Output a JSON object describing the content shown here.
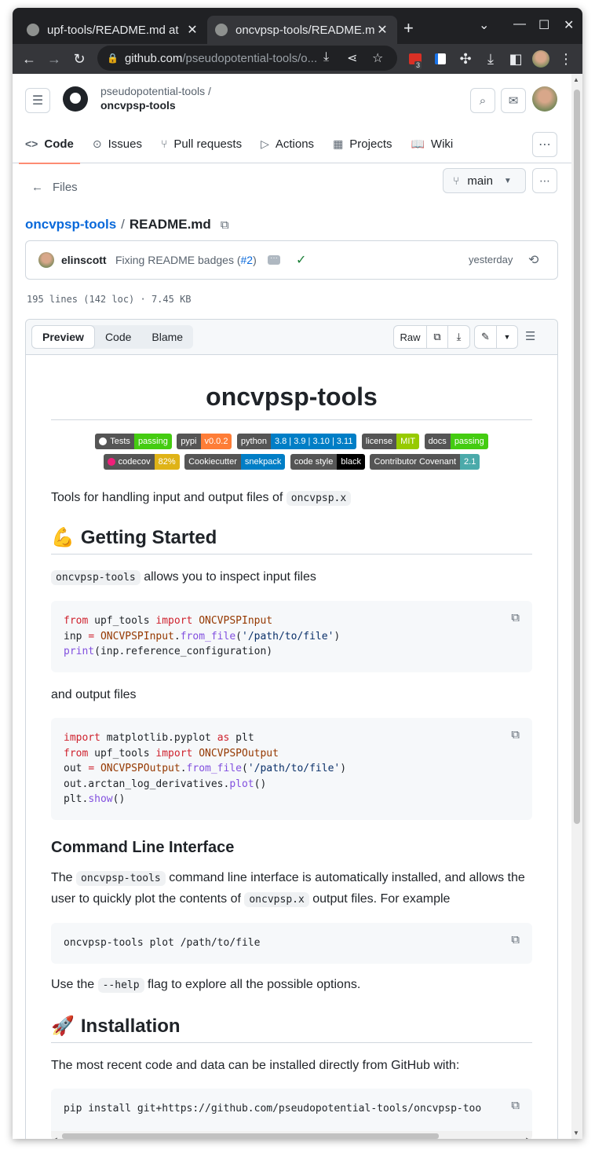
{
  "browser": {
    "tabs": [
      {
        "title": "upf-tools/README.md at",
        "active": false
      },
      {
        "title": "oncvpsp-tools/README.md",
        "active": true
      }
    ],
    "new_tab": "+",
    "url_host": "github.com",
    "url_path": "/pseudopotential-tools/o...",
    "extension_badge": "3"
  },
  "header": {
    "owner": "pseudopotential-tools /",
    "repo": "oncvpsp-tools",
    "nav": [
      {
        "label": "Code",
        "icon": "code-icon",
        "glyph": "<>"
      },
      {
        "label": "Issues",
        "icon": "issue-icon",
        "glyph": "⊙"
      },
      {
        "label": "Pull requests",
        "icon": "pull-request-icon",
        "glyph": "⑂"
      },
      {
        "label": "Actions",
        "icon": "play-icon",
        "glyph": "▷"
      },
      {
        "label": "Projects",
        "icon": "table-icon",
        "glyph": "▦"
      },
      {
        "label": "Wiki",
        "icon": "book-icon",
        "glyph": "📖"
      }
    ]
  },
  "files": {
    "back_label": "Files",
    "branch": "main",
    "breadcrumb_repo": "oncvpsp-tools",
    "breadcrumb_sep": "/",
    "breadcrumb_file": "README.md"
  },
  "commit": {
    "author": "elinscott",
    "message": "Fixing README badges (",
    "pr": "#2",
    "message_end": ")",
    "time": "yesterday"
  },
  "file_meta": "195 lines (142 loc) · 7.45 KB",
  "viewer": {
    "tabs": [
      "Preview",
      "Code",
      "Blame"
    ],
    "raw_label": "Raw"
  },
  "readme": {
    "title": "oncvpsp-tools",
    "badges_row1": [
      {
        "left": "Tests",
        "right": "passing",
        "color": "#44cc11",
        "icon": "github-icon"
      },
      {
        "left": "pypi",
        "right": "v0.0.2",
        "color": "#fe7d37"
      },
      {
        "left": "python",
        "right": "3.8 | 3.9 | 3.10 | 3.11",
        "color": "#007ec6"
      },
      {
        "left": "license",
        "right": "MIT",
        "color": "#97ca00"
      },
      {
        "left": "docs",
        "right": "passing",
        "color": "#4c1"
      }
    ],
    "badges_row2": [
      {
        "left": "codecov",
        "right": "82%",
        "color": "#dfb317",
        "icon": "codecov-icon"
      },
      {
        "left": "Cookiecutter",
        "right": "snekpack",
        "color": "#007ec6"
      },
      {
        "left": "code style",
        "right": "black",
        "color": "#000000"
      },
      {
        "left": "Contributor Covenant",
        "right": "2.1",
        "color": "#4baaaa"
      }
    ],
    "intro_text": "Tools for handling input and output files of ",
    "intro_code": "oncvpsp.x",
    "getting_started": "Getting Started",
    "gs_code": "oncvpsp-tools",
    "gs_text": " allows you to inspect input files",
    "and_output": "and output files",
    "cli_title": "Command Line Interface",
    "cli_p1": "The ",
    "cli_code1": "oncvpsp-tools",
    "cli_p2": " command line interface is automatically installed, and allows the user to quickly plot the contents of ",
    "cli_code2": "oncvpsp.x",
    "cli_p3": " output files. For example",
    "cli_cmd": "oncvpsp-tools plot /path/to/file",
    "help_p1": "Use the ",
    "help_code": "--help",
    "help_p2": " flag to explore all the possible options.",
    "installation": "Installation",
    "install_text": "The most recent code and data can be installed directly from GitHub with:",
    "install_cmd": "pip install git+https://github.com/pseudopotential-tools/oncvpsp-too"
  }
}
